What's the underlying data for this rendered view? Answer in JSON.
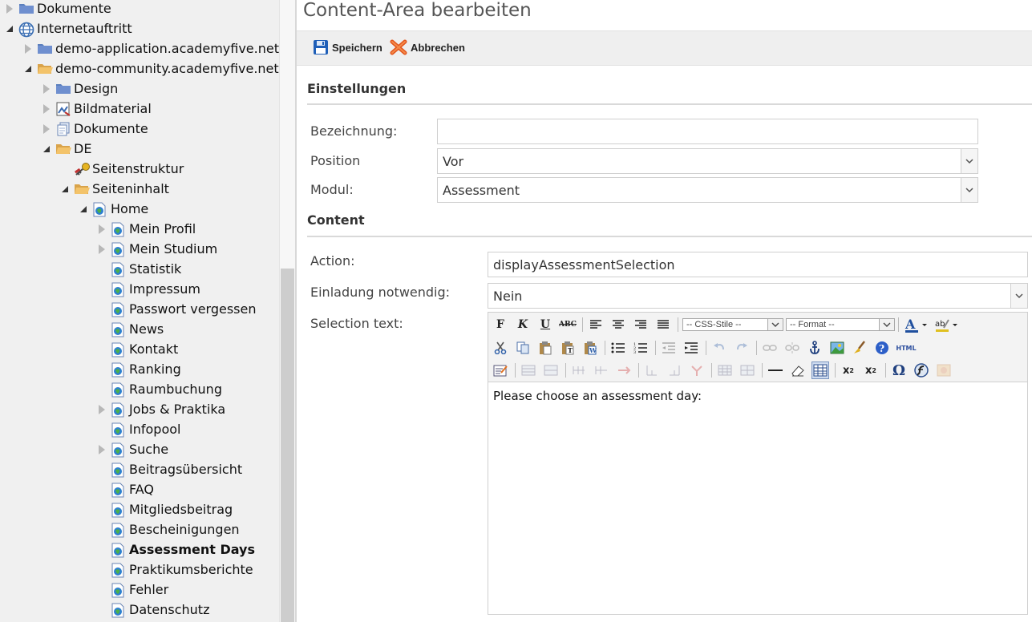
{
  "tree": {
    "items": [
      {
        "label": "Dokumente",
        "icon": "folder-icon",
        "toggle": "collapsed",
        "bold": false
      },
      {
        "label": "Internetauftritt",
        "icon": "globe-icon",
        "toggle": "expanded",
        "bold": false
      },
      {
        "label": "demo-application.academyfive.net",
        "icon": "folder-icon",
        "toggle": "collapsed",
        "bold": false
      },
      {
        "label": "demo-community.academyfive.net",
        "icon": "folder-open-icon",
        "toggle": "expanded",
        "bold": false
      },
      {
        "label": "Design",
        "icon": "folder-icon",
        "toggle": "collapsed",
        "bold": false
      },
      {
        "label": "Bildmaterial",
        "icon": "image-icon",
        "toggle": "collapsed",
        "bold": false
      },
      {
        "label": "Dokumente",
        "icon": "documents-icon",
        "toggle": "collapsed",
        "bold": false
      },
      {
        "label": "DE",
        "icon": "folder-open-icon",
        "toggle": "expanded",
        "bold": false
      },
      {
        "label": "Seitenstruktur",
        "icon": "key-icon",
        "toggle": "none",
        "bold": false
      },
      {
        "label": "Seiteninhalt",
        "icon": "folder-open-icon",
        "toggle": "expanded",
        "bold": false
      },
      {
        "label": "Home",
        "icon": "page-icon",
        "toggle": "expanded",
        "bold": false
      },
      {
        "label": "Mein Profil",
        "icon": "page-icon",
        "toggle": "collapsed",
        "bold": false
      },
      {
        "label": "Mein Studium",
        "icon": "page-icon",
        "toggle": "collapsed",
        "bold": false
      },
      {
        "label": "Statistik",
        "icon": "page-icon",
        "toggle": "none",
        "bold": false
      },
      {
        "label": "Impressum",
        "icon": "page-icon",
        "toggle": "none",
        "bold": false
      },
      {
        "label": "Passwort vergessen",
        "icon": "page-icon",
        "toggle": "none",
        "bold": false
      },
      {
        "label": "News",
        "icon": "page-icon",
        "toggle": "none",
        "bold": false
      },
      {
        "label": "Kontakt",
        "icon": "page-icon",
        "toggle": "none",
        "bold": false
      },
      {
        "label": "Ranking",
        "icon": "page-icon",
        "toggle": "none",
        "bold": false
      },
      {
        "label": "Raumbuchung",
        "icon": "page-icon",
        "toggle": "none",
        "bold": false
      },
      {
        "label": "Jobs & Praktika",
        "icon": "page-icon",
        "toggle": "collapsed",
        "bold": false
      },
      {
        "label": "Infopool",
        "icon": "page-icon",
        "toggle": "none",
        "bold": false
      },
      {
        "label": "Suche",
        "icon": "page-icon",
        "toggle": "collapsed",
        "bold": false
      },
      {
        "label": "Beitragsübersicht",
        "icon": "page-icon",
        "toggle": "none",
        "bold": false
      },
      {
        "label": "FAQ",
        "icon": "page-icon",
        "toggle": "none",
        "bold": false
      },
      {
        "label": "Mitgliedsbeitrag",
        "icon": "page-icon",
        "toggle": "none",
        "bold": false
      },
      {
        "label": "Bescheinigungen",
        "icon": "page-icon",
        "toggle": "none",
        "bold": false
      },
      {
        "label": "Assessment Days",
        "icon": "page-icon",
        "toggle": "none",
        "bold": true
      },
      {
        "label": "Praktikumsberichte",
        "icon": "page-icon",
        "toggle": "none",
        "bold": false
      },
      {
        "label": "Fehler",
        "icon": "page-icon",
        "toggle": "none",
        "bold": false
      },
      {
        "label": "Datenschutz",
        "icon": "page-icon",
        "toggle": "none",
        "bold": false
      }
    ]
  },
  "page": {
    "title": "Content-Area bearbeiten"
  },
  "toolbar": {
    "save_label": "Speichern",
    "cancel_label": "Abbrechen"
  },
  "settings": {
    "heading": "Einstellungen",
    "bezeichnung_label": "Bezeichnung:",
    "bezeichnung_value": "",
    "position_label": "Position",
    "position_value": "Vor",
    "modul_label": "Modul:",
    "modul_value": "Assessment"
  },
  "content": {
    "heading": "Content",
    "action_label": "Action:",
    "action_value": "displayAssessmentSelection",
    "einladung_label": "Einladung notwendig:",
    "einladung_value": "Nein",
    "selection_label": "Selection text:"
  },
  "editor": {
    "css_styles": "-- CSS-Stile --",
    "format": "-- Format --",
    "html_button": "HTML",
    "text": "Please choose an assessment day:"
  }
}
